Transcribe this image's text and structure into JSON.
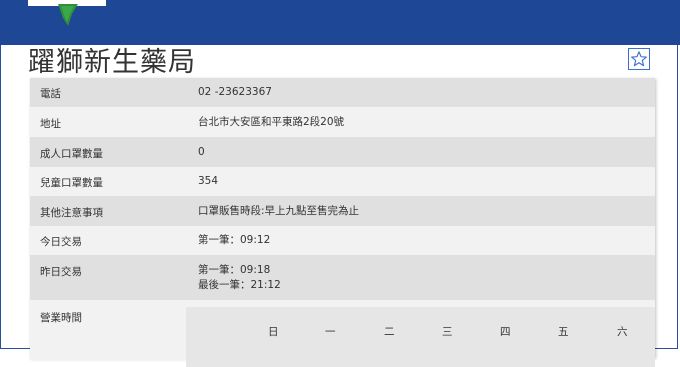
{
  "pharmacy": {
    "name": "躍獅新生藥局"
  },
  "rows": [
    {
      "label": "電話",
      "value": "02 -23623367"
    },
    {
      "label": "地址",
      "value": "台北市大安區和平東路2段20號"
    },
    {
      "label": "成人口罩數量",
      "value": "0"
    },
    {
      "label": "兒童口罩數量",
      "value": "354"
    },
    {
      "label": "其他注意事項",
      "value": "口罩販售時段:早上九點至售完為止"
    },
    {
      "label": "今日交易",
      "value": "第一筆：09:12"
    },
    {
      "label": "昨日交易",
      "value": "第一筆：09:18",
      "value2": "最後一筆：21:12"
    },
    {
      "label": "營業時間"
    }
  ],
  "weekdays": [
    "日",
    "一",
    "二",
    "三",
    "四",
    "五",
    "六"
  ],
  "icons": {
    "favorite": "star-icon",
    "logo": "taiwan-map-logo"
  },
  "colors": {
    "banner": "#1e4796",
    "star_outline": "#3a6fd0"
  }
}
